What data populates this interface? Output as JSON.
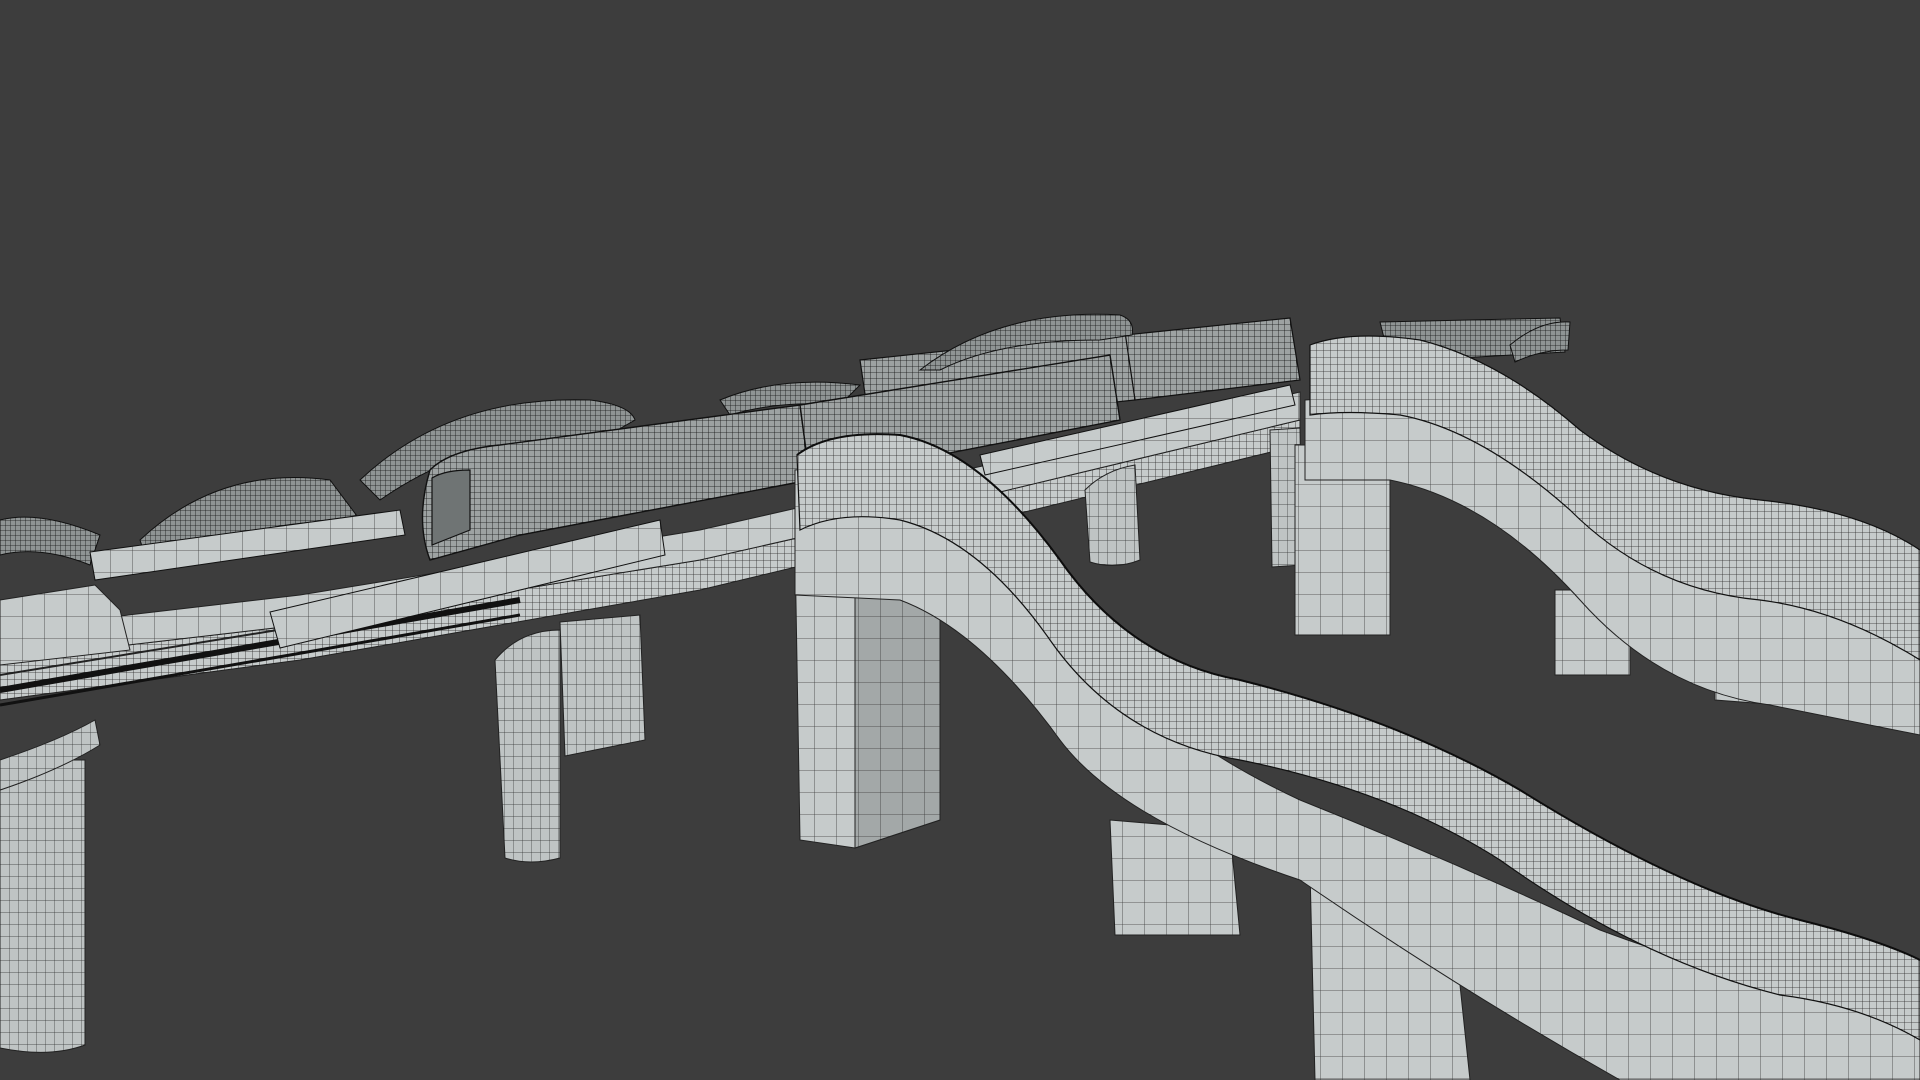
{
  "viewport": {
    "background": "#3d3d3d",
    "render_mode": "wireframe-on-shaded"
  },
  "scene": {
    "subject": "elevated-railway-station-with-curved-walkways",
    "colors": {
      "concrete": "#c6cbcb",
      "concrete_shadow": "#9aa0a0",
      "concrete_dark": "#7f8585",
      "wire": "#1a1a1a",
      "roof": "#a9aeae"
    }
  }
}
